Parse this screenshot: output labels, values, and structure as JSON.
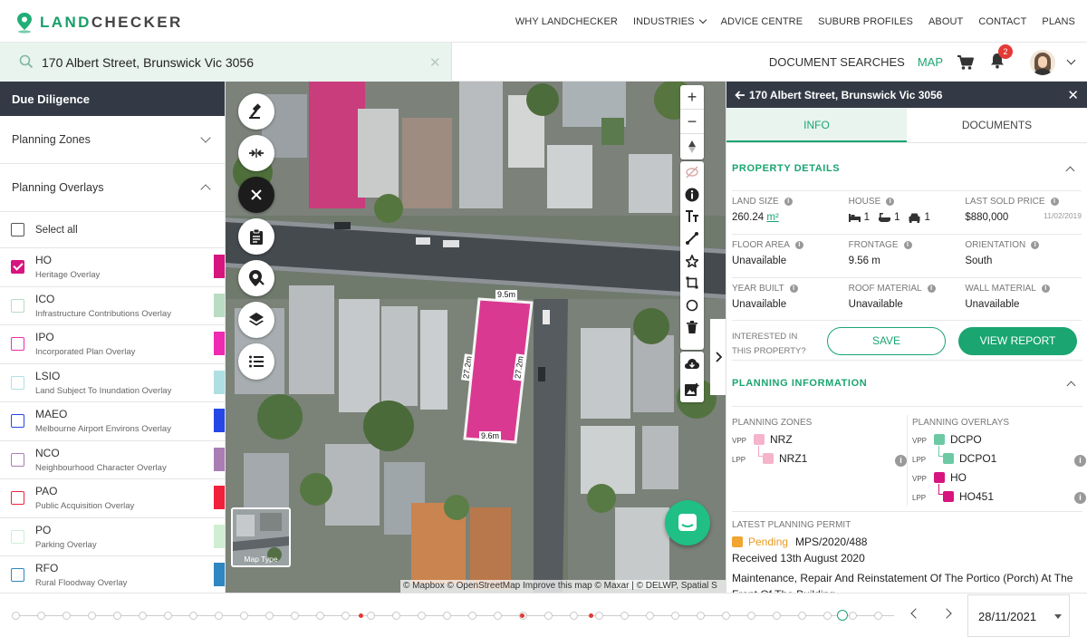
{
  "brand": {
    "name_green": "LAND",
    "name_dark": "CHECKER"
  },
  "nav": {
    "why": "WHY LANDCHECKER",
    "industries": "INDUSTRIES",
    "advice": "ADVICE CENTRE",
    "suburb": "SUBURB PROFILES",
    "about": "ABOUT",
    "contact": "CONTACT",
    "plans": "PLANS"
  },
  "search": {
    "value": "170 Albert Street, Brunswick Vic 3056"
  },
  "toolbar": {
    "document_searches": "DOCUMENT SEARCHES",
    "map": "MAP",
    "notifications_count": "2"
  },
  "left_panel": {
    "header": "Due Diligence",
    "planning_zones": "Planning Zones",
    "planning_overlays": "Planning Overlays",
    "select_all": "Select all",
    "overlays": [
      {
        "code": "HO",
        "name": "Heritage Overlay",
        "color": "#d6157f",
        "checked": true
      },
      {
        "code": "ICO",
        "name": "Infrastructure Contributions Overlay",
        "color": "#b9dcc2",
        "checked": false
      },
      {
        "code": "IPO",
        "name": "Incorporated Plan Overlay",
        "color": "#ee2bb1",
        "checked": false
      },
      {
        "code": "LSIO",
        "name": "Land Subject To Inundation Overlay",
        "color": "#aee0e3",
        "checked": false
      },
      {
        "code": "MAEO",
        "name": "Melbourne Airport Environs Overlay",
        "color": "#2547e6",
        "checked": false
      },
      {
        "code": "NCO",
        "name": "Neighbourhood Character Overlay",
        "color": "#a97db3",
        "checked": false
      },
      {
        "code": "PAO",
        "name": "Public Acquisition Overlay",
        "color": "#f1213b",
        "checked": false
      },
      {
        "code": "PO",
        "name": "Parking Overlay",
        "color": "#cfeed2",
        "checked": false
      },
      {
        "code": "RFO",
        "name": "Rural Floodway Overlay",
        "color": "#2f86c1",
        "checked": false
      }
    ]
  },
  "map": {
    "map_type": "Map Type",
    "dims": {
      "top": "9.5m",
      "bottom": "9.6m",
      "left": "27.2m",
      "right": "27.2m"
    },
    "attribution": "© Mapbox © OpenStreetMap  Improve this map  © Maxar | © DELWP, Spatial S"
  },
  "right_panel": {
    "title": "170 Albert Street, Brunswick Vic 3056",
    "tab_info": "INFO",
    "tab_documents": "DOCUMENTS",
    "property_details": "PROPERTY DETAILS",
    "land_size_label": "LAND SIZE",
    "land_size": "260.24",
    "land_size_unit": "m²",
    "house_label": "HOUSE",
    "beds": "1",
    "baths": "1",
    "cars": "1",
    "last_sold_label": "LAST SOLD PRICE",
    "last_sold": "$880,000",
    "last_sold_date": "11/02/2019",
    "floor_area_label": "FLOOR AREA",
    "floor_area": "Unavailable",
    "frontage_label": "FRONTAGE",
    "frontage": "9.56 m",
    "orientation_label": "ORIENTATION",
    "orientation": "South",
    "year_built_label": "YEAR BUILT",
    "year_built": "Unavailable",
    "roof_label": "ROOF MATERIAL",
    "roof": "Unavailable",
    "wall_label": "WALL MATERIAL",
    "wall": "Unavailable",
    "interested_1": "INTERESTED IN",
    "interested_2": "THIS PROPERTY?",
    "save": "SAVE",
    "view_report": "VIEW REPORT",
    "planning_info": "PLANNING INFORMATION",
    "zones_label": "PLANNING ZONES",
    "overlays_label": "PLANNING OVERLAYS",
    "vpp": "VPP",
    "lpp": "LPP",
    "zone_vpp": "NRZ",
    "zone_lpp": "NRZ1",
    "ov1_vpp": "DCPO",
    "ov1_lpp": "DCPO1",
    "ov2_vpp": "HO",
    "ov2_lpp": "HO451",
    "permit_label": "LATEST PLANNING PERMIT",
    "permit_status": "Pending",
    "permit_no": "MPS/2020/488",
    "permit_received": "Received 13th August 2020",
    "permit_desc": "Maintenance, Repair And Reinstatement Of The Portico (Porch) At The Front Of The Building"
  },
  "timeline": {
    "date": "28/11/2021"
  }
}
